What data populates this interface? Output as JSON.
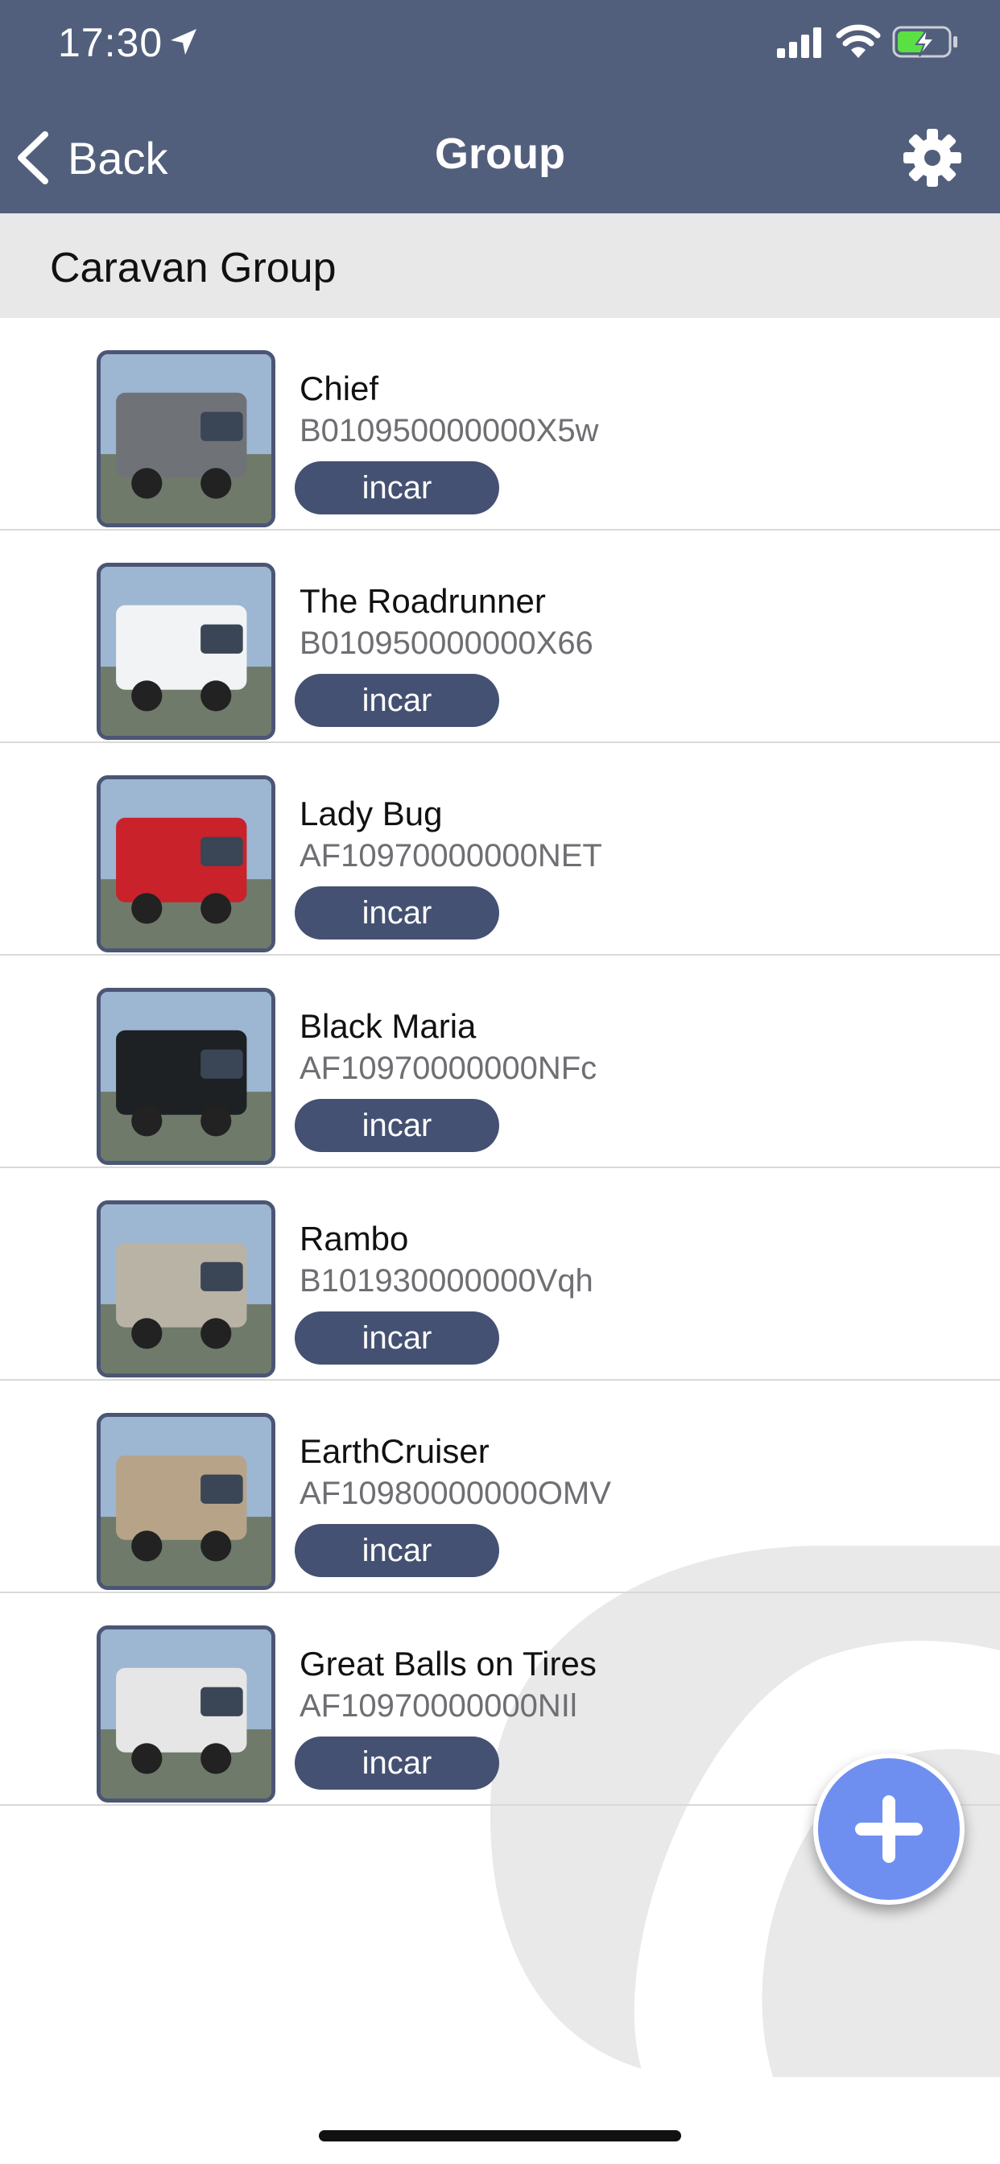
{
  "status_bar": {
    "time": "17:30"
  },
  "nav": {
    "back_label": "Back",
    "title": "Group"
  },
  "section": {
    "title": "Caravan Group"
  },
  "vehicles": [
    {
      "name": "Chief",
      "code": "B010950000000X5w",
      "action": "incar",
      "photo_color": "#6f7378"
    },
    {
      "name": "The Roadrunner",
      "code": "B010950000000X66",
      "action": "incar",
      "photo_color": "#f2f3f5"
    },
    {
      "name": "Lady Bug",
      "code": "AF10970000000NET",
      "action": "incar",
      "photo_color": "#c9222a"
    },
    {
      "name": "Black Maria",
      "code": "AF10970000000NFc",
      "action": "incar",
      "photo_color": "#1d2124"
    },
    {
      "name": "Rambo",
      "code": "B101930000000Vqh",
      "action": "incar",
      "photo_color": "#b9b3a5"
    },
    {
      "name": "EarthCruiser",
      "code": "AF10980000000OMV",
      "action": "incar",
      "photo_color": "#b7a488"
    },
    {
      "name": "Great Balls on Tires",
      "code": "AF10970000000NIl",
      "action": "incar",
      "photo_color": "#e6e6e6"
    }
  ],
  "colors": {
    "header": "#525f7c",
    "button": "#455172",
    "fab": "#6f8ff0"
  }
}
